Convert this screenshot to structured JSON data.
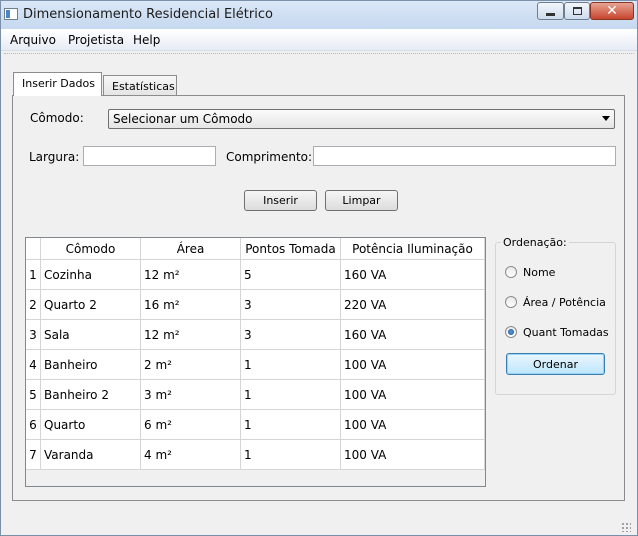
{
  "window": {
    "title": "Dimensionamento Residencial Elétrico"
  },
  "menu": [
    "Arquivo",
    "Projetista",
    "Help"
  ],
  "tabs": [
    {
      "label": "Inserir Dados",
      "active": true
    },
    {
      "label": "Estatísticas",
      "active": false
    }
  ],
  "form": {
    "comodo_label": "Cômodo:",
    "comodo_selected": "Selecionar um Cômodo",
    "largura_label": "Largura:",
    "largura_value": "",
    "comprimento_label": "Comprimento:",
    "comprimento_value": "",
    "inserir_button": "Inserir",
    "limpar_button": "Limpar"
  },
  "table": {
    "columns": [
      "Cômodo",
      "Área",
      "Pontos Tomada",
      "Potência Iluminação"
    ],
    "rows": [
      {
        "n": "1",
        "cells": [
          "Cozinha",
          "12 m²",
          "5",
          "160 VA"
        ]
      },
      {
        "n": "2",
        "cells": [
          "Quarto 2",
          "16 m²",
          "3",
          "220 VA"
        ]
      },
      {
        "n": "3",
        "cells": [
          "Sala",
          "12 m²",
          "3",
          "160 VA"
        ]
      },
      {
        "n": "4",
        "cells": [
          "Banheiro",
          "2 m²",
          "1",
          "100 VA"
        ]
      },
      {
        "n": "5",
        "cells": [
          "Banheiro 2",
          "3 m²",
          "1",
          "100 VA"
        ]
      },
      {
        "n": "6",
        "cells": [
          "Quarto",
          "6 m²",
          "1",
          "100 VA"
        ]
      },
      {
        "n": "7",
        "cells": [
          "Varanda",
          "4 m²",
          "1",
          "100 VA"
        ]
      }
    ]
  },
  "ordenacao": {
    "title": "Ordenação:",
    "options": [
      {
        "label": "Nome",
        "checked": false
      },
      {
        "label": "Área / Potência",
        "checked": false
      },
      {
        "label": "Quant Tomadas",
        "checked": true
      }
    ],
    "button": "Ordenar"
  },
  "icons": {
    "app": "app-window-icon",
    "minimize": "minimize-icon",
    "maximize": "maximize-icon",
    "close": "close-icon",
    "dropdown": "chevron-down-icon",
    "resize": "resize-grip-icon"
  },
  "colors": {
    "titlebar": "#c5d8ef",
    "close_button": "#c7442e",
    "default_button_border": "#3c7fb1"
  }
}
